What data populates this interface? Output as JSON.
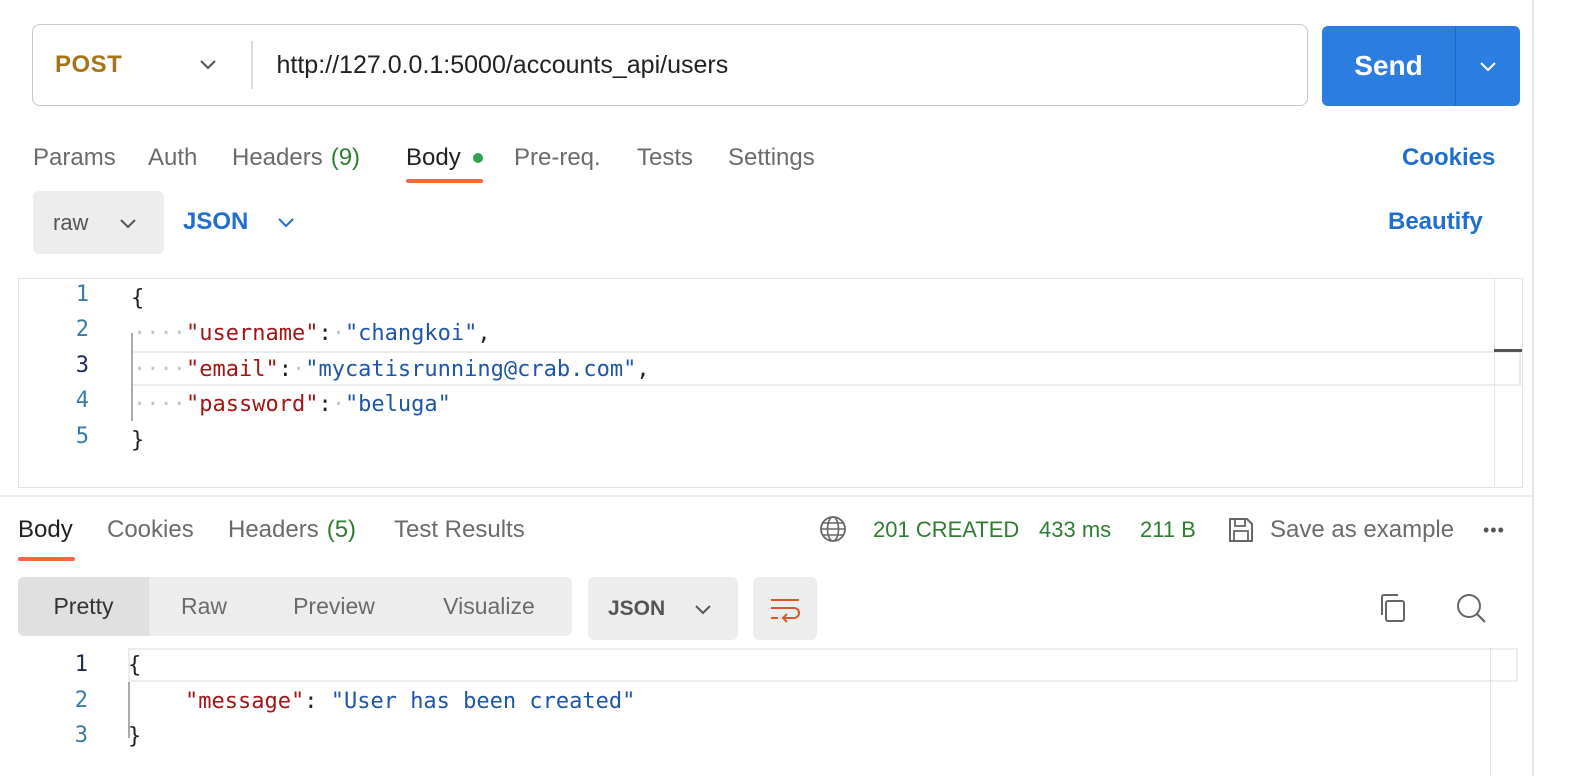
{
  "request": {
    "method": "POST",
    "url": "http://127.0.0.1:5000/accounts_api/users",
    "send_label": "Send"
  },
  "request_tabs": {
    "params": "Params",
    "auth": "Auth",
    "headers": "Headers",
    "headers_count": "(9)",
    "body": "Body",
    "prereq": "Pre-req.",
    "tests": "Tests",
    "settings": "Settings",
    "cookies": "Cookies"
  },
  "body_options": {
    "mode": "raw",
    "language": "JSON",
    "beautify": "Beautify"
  },
  "request_body": {
    "line_numbers": [
      "1",
      "2",
      "3",
      "4",
      "5"
    ],
    "open_brace": "{",
    "close_brace": "}",
    "fields": [
      {
        "key": "\"username\"",
        "value": "\"changkoi\"",
        "trail": ","
      },
      {
        "key": "\"email\"",
        "value": "\"mycatisrunning@crab.com\"",
        "trail": ","
      },
      {
        "key": "\"password\"",
        "value": "\"beluga\"",
        "trail": ""
      }
    ],
    "colon": ":"
  },
  "response_tabs": {
    "body": "Body",
    "cookies": "Cookies",
    "headers": "Headers",
    "headers_count": "(5)",
    "test_results": "Test Results"
  },
  "response_status": {
    "status": "201 CREATED",
    "time": "433 ms",
    "size": "211 B",
    "save_example": "Save as example",
    "more": "•••"
  },
  "response_view": {
    "pretty": "Pretty",
    "raw": "Raw",
    "preview": "Preview",
    "visualize": "Visualize",
    "format": "JSON"
  },
  "response_body": {
    "line_numbers": [
      "1",
      "2",
      "3"
    ],
    "open_brace": "{",
    "close_brace": "}",
    "key": "\"message\"",
    "colon": ":",
    "value": "\"User has been created\""
  },
  "colors": {
    "accent_blue": "#2b7de0",
    "method_color": "#a8741a",
    "tab_underline": "#ee6a3d",
    "success_green": "#2e7d32",
    "json_key": "#a31515",
    "json_string": "#1f55a8"
  }
}
